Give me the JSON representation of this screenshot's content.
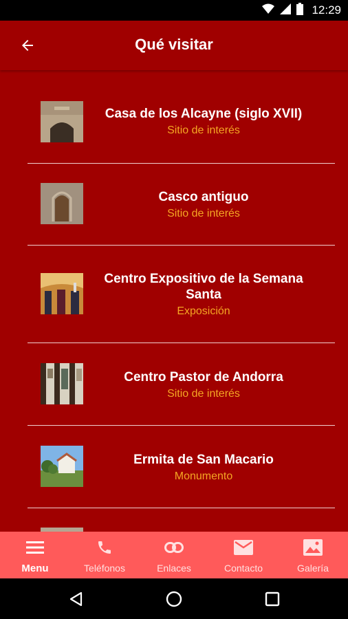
{
  "status_bar": {
    "time": "12:29",
    "icons": [
      "wifi-icon",
      "cell-signal-icon",
      "battery-icon"
    ]
  },
  "app_bar": {
    "title": "Qué visitar",
    "back_icon": "arrow-left-icon"
  },
  "items": [
    {
      "title": "Casa de los Alcayne (siglo XVII)",
      "subtitle": "Sitio de interés"
    },
    {
      "title": "Casco antiguo",
      "subtitle": "Sitio de interés"
    },
    {
      "title": "Centro Expositivo de la Semana Santa",
      "subtitle": "Exposición"
    },
    {
      "title": "Centro Pastor de Andorra",
      "subtitle": "Sitio de interés"
    },
    {
      "title": "Ermita de San Macario",
      "subtitle": "Monumento"
    }
  ],
  "bottom_nav": [
    {
      "label": "Menu",
      "icon": "hamburger-icon",
      "active": true
    },
    {
      "label": "Teléfonos",
      "icon": "phone-icon"
    },
    {
      "label": "Enlaces",
      "icon": "link-icon"
    },
    {
      "label": "Contacto",
      "icon": "mail-icon"
    },
    {
      "label": "Galería",
      "icon": "gallery-icon"
    }
  ],
  "colors": {
    "background": "#a00000",
    "subtitle": "#f5a623",
    "bottom_nav": "#ff5a5a"
  }
}
